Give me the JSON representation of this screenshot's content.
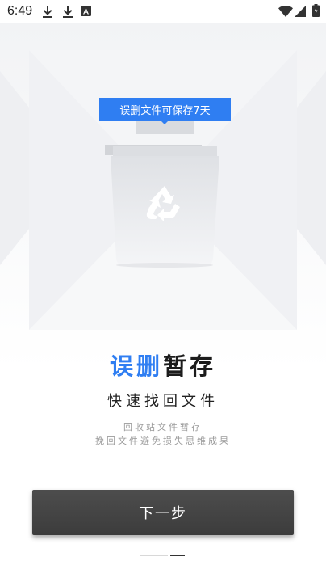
{
  "status_bar": {
    "time": "6:49",
    "left_icons": [
      "download-icon",
      "download-icon",
      "app-a-icon"
    ],
    "right_icons": [
      "wifi-icon",
      "signal-icon",
      "battery-icon"
    ]
  },
  "illustration": {
    "tooltip": "误删文件可保存7天",
    "bin_icon": "recycle-icon"
  },
  "headline": {
    "accent": "误删",
    "rest": "暂存"
  },
  "subhead": "快速找回文件",
  "description": {
    "line1": "回收站文件暂存",
    "line2": "挽回文件避免损失思维成果"
  },
  "next_button": "下一步",
  "pager": {
    "pages": 2,
    "active": 2
  },
  "colors": {
    "accent": "#2f7ef2",
    "button": "#444444"
  }
}
